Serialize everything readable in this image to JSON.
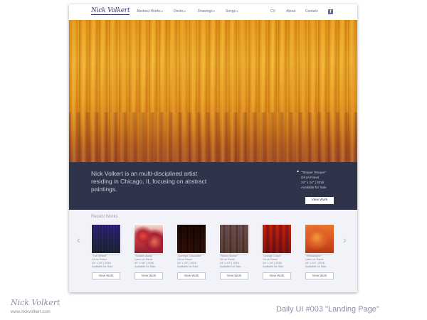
{
  "nav": {
    "logo": "Nick Volkert",
    "items": [
      {
        "label": "Abstract Works",
        "dropdown": true
      },
      {
        "label": "Decks",
        "dropdown": true
      },
      {
        "label": "Drawings",
        "dropdown": true
      },
      {
        "label": "Songs",
        "dropdown": true
      },
      {
        "label": "CV",
        "dropdown": false
      },
      {
        "label": "About",
        "dropdown": false
      },
      {
        "label": "Contact",
        "dropdown": false
      }
    ],
    "caret": "▾",
    "social_icon": "facebook-icon",
    "social_glyph": "f"
  },
  "hero": {
    "tagline": "Nick Volkert is an multi-disciplined artist residing in Chicago, IL focusing on abstract paintings.",
    "featured": {
      "title": "\"Temper Temper\"",
      "medium": "Oil on Panel",
      "size_year": "24\" x 24\" | 2016",
      "availability": "Available for Sale",
      "button": "View Work"
    },
    "arrow_glyph": "▲"
  },
  "recent": {
    "title": "Recent Works",
    "prev_glyph": "‹",
    "next_glyph": "›",
    "works": [
      {
        "title": "\"The Wheel\"",
        "medium": "Oil on Panel",
        "size_year": "24\" x 24\" | 2016",
        "availability": "Available for Sale",
        "button": "View Work"
      },
      {
        "title": "\"Scratch Away\"",
        "medium": "Latex on Panel",
        "size_year": "30\" x 36\" | 2016",
        "availability": "Available for Sale",
        "button": "View Work"
      },
      {
        "title": "\"German Chocolate\"",
        "medium": "Oil on Panel",
        "size_year": "24\" x 24\" | 2016",
        "availability": "Available for Sale",
        "button": "View Work"
      },
      {
        "title": "\"Raven Brown\"",
        "medium": "Oil on Panel",
        "size_year": "24\" x 24\" | 2016",
        "availability": "Available for Sale",
        "button": "View Work"
      },
      {
        "title": "\"Orange Crush\"",
        "medium": "Oil on Panel",
        "size_year": "24\" x 24\" | 2016",
        "availability": "Available for Sale",
        "button": "View Work"
      },
      {
        "title": "\"Yellowstone\"",
        "medium": "Latex on Panel",
        "size_year": "24\" x 24\" | 2016",
        "availability": "Available for Sale",
        "button": "View Work"
      }
    ]
  },
  "footer": {
    "signature": "Nick Volkert",
    "website": "www.nickvolkert.com",
    "caption": "Daily UI #003 \"Landing Page\""
  }
}
